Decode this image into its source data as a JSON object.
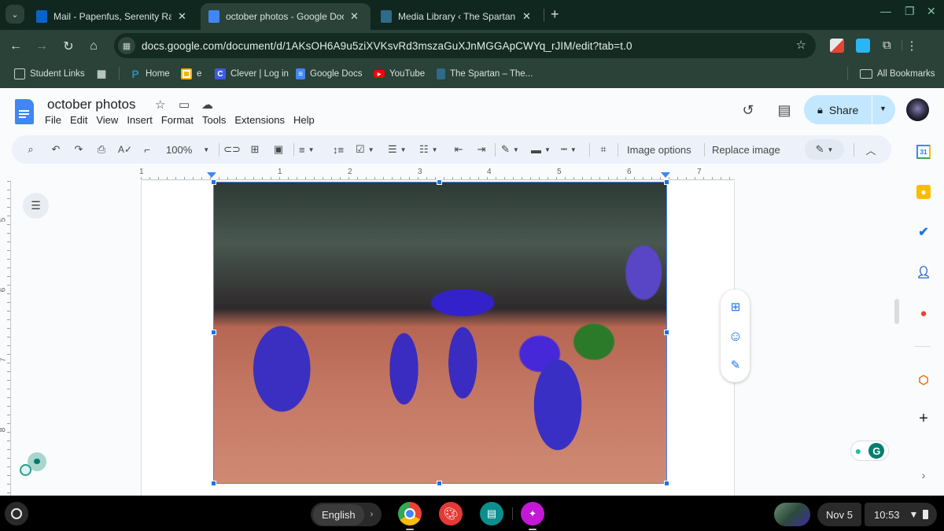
{
  "browser": {
    "tabs": [
      {
        "title": "Mail - Papenfus, Serenity Rae - Outlook",
        "icon": "outlook-icon",
        "active": false
      },
      {
        "title": "october photos - Google Docs",
        "icon": "google-docs-icon",
        "active": true
      },
      {
        "title": "Media Library ‹ The Spartan — WordPress",
        "icon": "the-spartan-icon",
        "active": false
      }
    ],
    "url": "docs.google.com/document/d/1AKsOH6A9u5ziXVKsvRd3mszaGuXJnMGGApCWYq_rJIM/edit?tab=t.0",
    "bookmarks": [
      {
        "label": "Student Links",
        "icon": "folder-settings-icon"
      },
      {
        "label": "",
        "icon": "apps-grid-icon"
      },
      {
        "label": "Home",
        "icon": "pearson-p-icon"
      },
      {
        "label": "e",
        "icon": "google-slides-icon"
      },
      {
        "label": "Clever | Log in",
        "icon": "clever-icon"
      },
      {
        "label": "Google Docs",
        "icon": "google-docs-icon"
      },
      {
        "label": "YouTube",
        "icon": "youtube-icon"
      },
      {
        "label": "The Spartan – The...",
        "icon": "the-spartan-icon"
      }
    ],
    "all_bookmarks_label": "All Bookmarks"
  },
  "docs": {
    "title": "october photos",
    "menu": [
      "File",
      "Edit",
      "View",
      "Insert",
      "Format",
      "Tools",
      "Extensions",
      "Help"
    ],
    "share_label": "Share",
    "toolbar": {
      "zoom": "100%",
      "image_options": "Image options",
      "replace_image": "Replace image"
    },
    "ruler_h": [
      "1",
      "1",
      "2",
      "3",
      "4",
      "5",
      "6",
      "7"
    ],
    "ruler_v": [
      "5",
      "6",
      "7",
      "8"
    ],
    "image_alt": "Cheerleaders in blue and green tracksuits with pom-poms on a running track"
  },
  "shelf": {
    "ime_label": "English",
    "date": "Nov 5",
    "time": "10:53",
    "apps": [
      "chrome-icon",
      "canvas-paint-icon",
      "classroom-reader-icon",
      "drawing-app-icon"
    ]
  }
}
